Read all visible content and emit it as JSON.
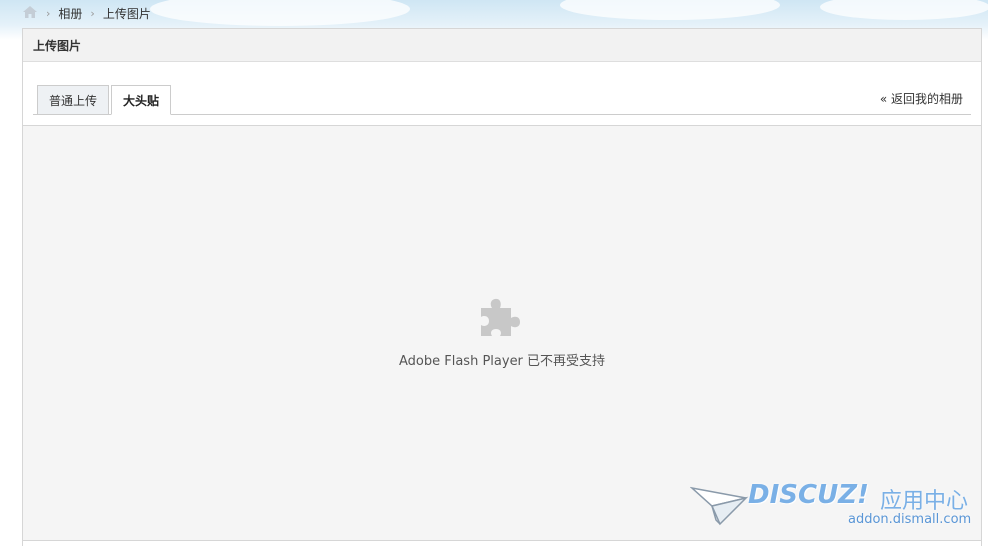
{
  "breadcrumb": {
    "home_icon": "home-icon",
    "separator": "›",
    "items": [
      "相册",
      "上传图片"
    ]
  },
  "panel": {
    "title": "上传图片"
  },
  "tabs": [
    {
      "label": "普通上传",
      "active": false
    },
    {
      "label": "大头贴",
      "active": true
    }
  ],
  "back_link": "« 返回我的相册",
  "flash": {
    "icon": "puzzle-piece-icon",
    "message": "Adobe Flash Player 已不再受支持"
  },
  "watermark": {
    "brand": "DISCUZ!",
    "app_center": "应用中心",
    "url": "addon.dismall.com"
  },
  "colors": {
    "panel_header_bg": "#f2f2f2",
    "flash_bg": "#f5f5f5",
    "watermark_blue": "#7ab0e6",
    "tab_inactive_bg": "#eef1f4"
  }
}
